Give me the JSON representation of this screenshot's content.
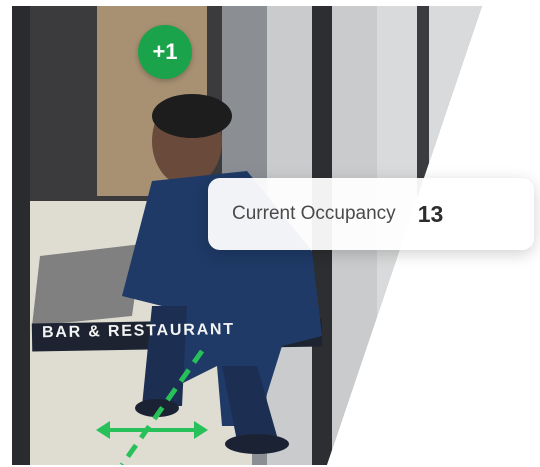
{
  "badge": {
    "label": "+1",
    "color": "#1aa34a"
  },
  "occupancy": {
    "label": "Current Occupancy",
    "count": "13"
  },
  "storefront": {
    "label": "BAR & RESTAURANT"
  },
  "icons": {
    "crossing_line": "dashed-line-icon",
    "direction": "double-arrow-icon"
  },
  "colors": {
    "accent": "#1aa34a",
    "card_bg": "#ffffff",
    "text": "#2d2d2d"
  }
}
